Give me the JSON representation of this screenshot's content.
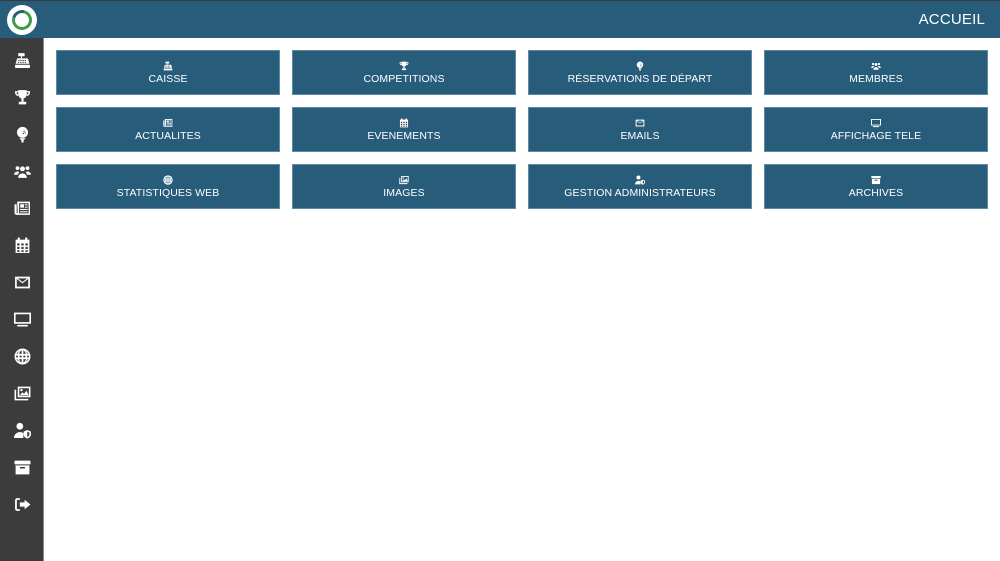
{
  "header": {
    "title": "ACCUEIL",
    "logo": "club-logo-ring",
    "colors": {
      "bar": "#275d7b",
      "logo_accent": "#3f9a49"
    }
  },
  "sidebar": {
    "items": [
      {
        "icon": "cash-register-icon",
        "target": "caisse"
      },
      {
        "icon": "trophy-icon",
        "target": "competitions"
      },
      {
        "icon": "golf-ball-tee-icon",
        "target": "reservations"
      },
      {
        "icon": "users-icon",
        "target": "membres"
      },
      {
        "icon": "newspaper-icon",
        "target": "actualites"
      },
      {
        "icon": "calendar-icon",
        "target": "evenements"
      },
      {
        "icon": "envelope-icon",
        "target": "emails"
      },
      {
        "icon": "tv-icon",
        "target": "affichage-tele"
      },
      {
        "icon": "globe-icon",
        "target": "statistiques-web"
      },
      {
        "icon": "images-icon",
        "target": "images"
      },
      {
        "icon": "user-shield-icon",
        "target": "gestion-administrateurs"
      },
      {
        "icon": "archive-box-icon",
        "target": "archives"
      },
      {
        "icon": "sign-out-icon",
        "target": "logout"
      }
    ]
  },
  "tiles": [
    {
      "label": "CAISSE",
      "icon": "cash-register-icon"
    },
    {
      "label": "COMPETITIONS",
      "icon": "trophy-icon"
    },
    {
      "label": "RÉSERVATIONS DE DÉPART",
      "icon": "golf-ball-tee-icon"
    },
    {
      "label": "MEMBRES",
      "icon": "users-icon"
    },
    {
      "label": "ACTUALITES",
      "icon": "newspaper-icon"
    },
    {
      "label": "EVENEMENTS",
      "icon": "calendar-icon"
    },
    {
      "label": "EMAILS",
      "icon": "envelope-icon"
    },
    {
      "label": "AFFICHAGE TELE",
      "icon": "tv-icon"
    },
    {
      "label": "STATISTIQUES WEB",
      "icon": "globe-icon"
    },
    {
      "label": "IMAGES",
      "icon": "images-icon"
    },
    {
      "label": "GESTION ADMINISTRATEURS",
      "icon": "user-shield-icon"
    },
    {
      "label": "ARCHIVES",
      "icon": "archive-box-icon"
    }
  ]
}
